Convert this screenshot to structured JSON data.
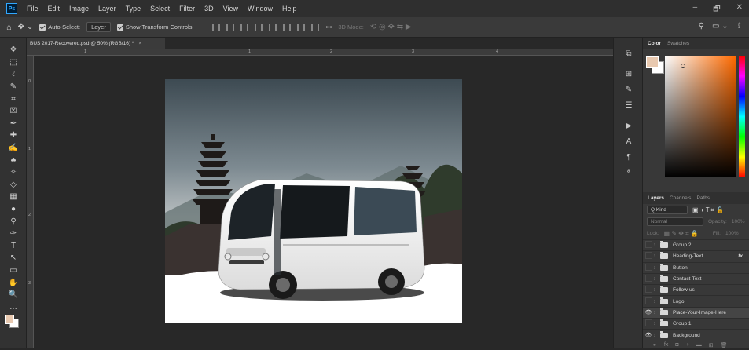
{
  "menubar": {
    "logo": "Ps",
    "items": [
      "File",
      "Edit",
      "Image",
      "Layer",
      "Type",
      "Select",
      "Filter",
      "3D",
      "View",
      "Window",
      "Help"
    ],
    "controls": [
      "–",
      "🗗",
      "✕"
    ]
  },
  "options": {
    "auto_select_label": "Auto-Select:",
    "auto_select_value": "Layer",
    "show_transform_label": "Show Transform Controls",
    "more": "•••",
    "mode_3d": "3D Mode:"
  },
  "document": {
    "tab_title": "BUS 2017-Recovered.psd @ 50% (RGB/16) *",
    "ruler_labels": [
      "0",
      "1",
      "2",
      "3",
      "4"
    ]
  },
  "colors": {
    "foreground": "#e8c9b0",
    "background": "#ffffff",
    "ps_blue": "#31a8ff"
  },
  "tools": [
    "move-tool",
    "marquee-tool",
    "lasso-tool",
    "quick-select-tool",
    "crop-tool",
    "frame-tool",
    "eyedropper-tool",
    "healing-tool",
    "brush-tool",
    "clone-stamp-tool",
    "history-brush-tool",
    "eraser-tool",
    "gradient-tool",
    "blur-tool",
    "dodge-tool",
    "pen-tool",
    "type-tool",
    "path-select-tool",
    "rectangle-tool",
    "hand-tool",
    "zoom-tool",
    "more-tools"
  ],
  "tool_glyphs": [
    "✥",
    "⬚",
    "ℓ",
    "✎",
    "⌗",
    "☒",
    "✒",
    "✚",
    "✍",
    "♣",
    "✧",
    "◇",
    "▦",
    "●",
    "⚲",
    "✑",
    "T",
    "↖",
    "▭",
    "✋",
    "🔍",
    "…"
  ],
  "panel": {
    "color_tabs": [
      "Color",
      "Swatches"
    ],
    "layer_tabs": [
      "Layers",
      "Channels",
      "Paths"
    ],
    "kind": "Q Kind",
    "blend_mode": "Normal",
    "opacity_label": "Opacity:",
    "opacity": "100%",
    "lock_label": "Lock:",
    "fill_label": "Fill:",
    "fill": "100%",
    "layers": [
      {
        "name": "Group 2",
        "visible": false,
        "fx": false,
        "selected": false
      },
      {
        "name": "Heading-Text",
        "visible": false,
        "fx": true,
        "selected": false
      },
      {
        "name": "Button",
        "visible": false,
        "fx": false,
        "selected": false
      },
      {
        "name": "Contact-Text",
        "visible": false,
        "fx": false,
        "selected": false
      },
      {
        "name": "Follow-us",
        "visible": false,
        "fx": false,
        "selected": false
      },
      {
        "name": "Logo",
        "visible": false,
        "fx": false,
        "selected": false
      },
      {
        "name": "Place-Your-Image-Here",
        "visible": true,
        "fx": false,
        "selected": true
      },
      {
        "name": "Group 1",
        "visible": false,
        "fx": false,
        "selected": false
      },
      {
        "name": "Background",
        "visible": true,
        "fx": false,
        "selected": false
      }
    ]
  }
}
